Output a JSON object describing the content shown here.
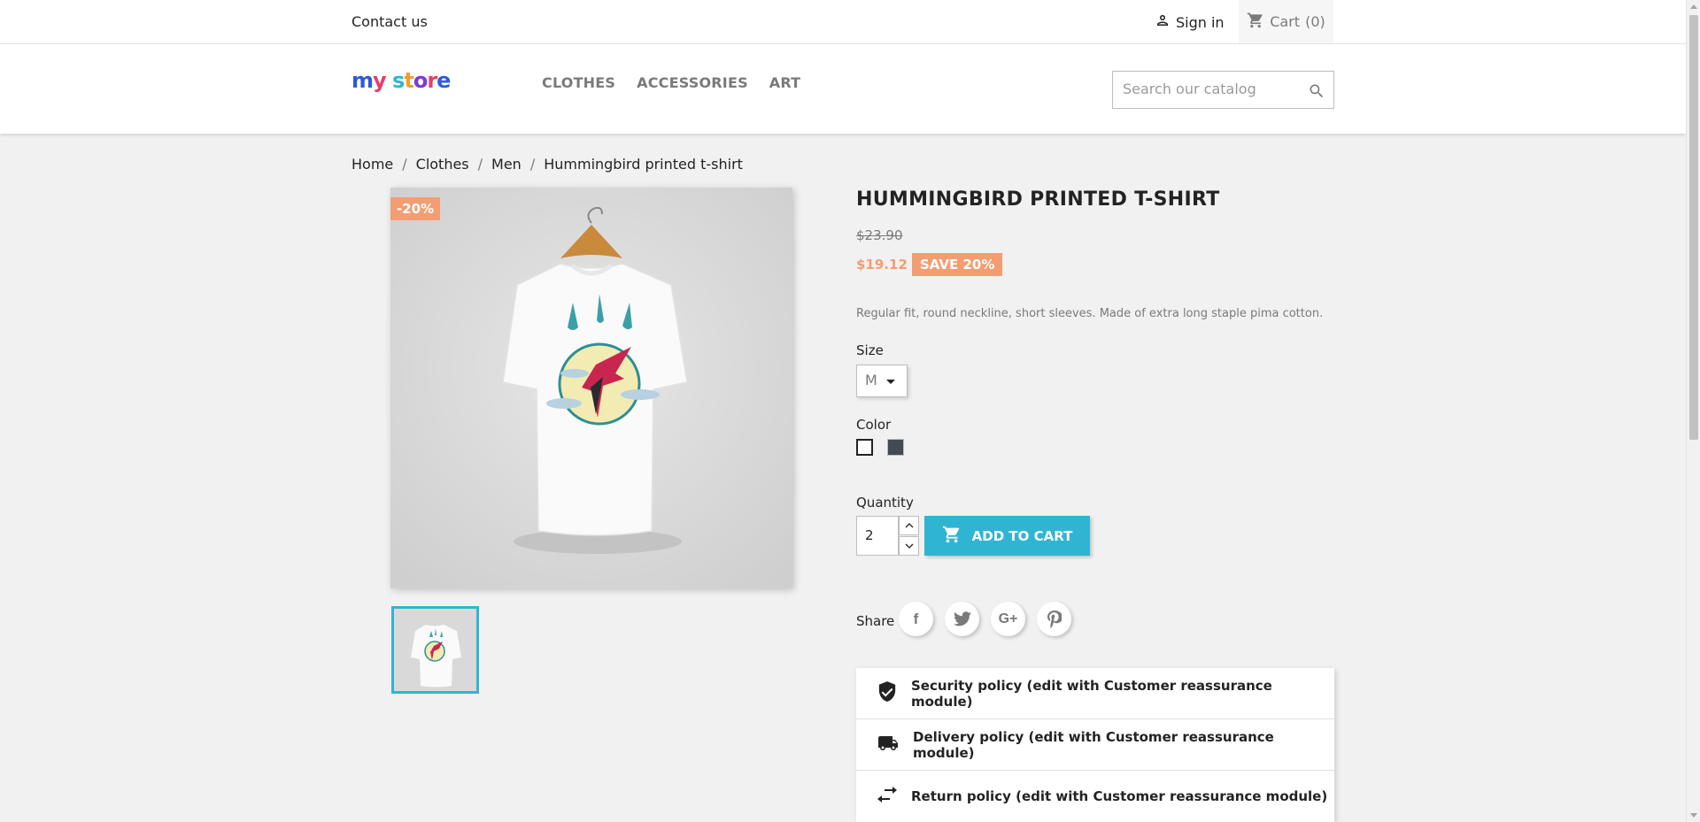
{
  "topbar": {
    "contact_label": "Contact us",
    "signin_label": "Sign in",
    "cart_label": "Cart",
    "cart_count": "(0)"
  },
  "header": {
    "logo_text": "my store",
    "nav": [
      "CLOTHES",
      "ACCESSORIES",
      "ART"
    ],
    "search_placeholder": "Search our catalog"
  },
  "breadcrumb": {
    "items": [
      "Home",
      "Clothes",
      "Men",
      "Hummingbird printed t-shirt"
    ],
    "separator": "/"
  },
  "product": {
    "discount_flag": "-20%",
    "title": "HUMMINGBIRD PRINTED T-SHIRT",
    "old_price": "$23.90",
    "new_price": "$19.12",
    "save_badge": "SAVE 20%",
    "description": "Regular fit, round neckline, short sleeves. Made of extra long staple pima cotton.",
    "size_label": "Size",
    "size_value": "M",
    "color_label": "Color",
    "colors": [
      {
        "name": "White",
        "hex": "#ffffff",
        "selected": true
      },
      {
        "name": "Black",
        "hex": "#434a54",
        "selected": false
      }
    ],
    "quantity_label": "Quantity",
    "quantity_value": "2",
    "add_to_cart_label": "ADD TO CART",
    "share_label": "Share",
    "share_buttons": [
      "facebook-icon",
      "twitter-icon",
      "googleplus-icon",
      "pinterest-icon"
    ]
  },
  "reassurance": [
    {
      "icon": "shield-check-icon",
      "label": "Security policy (edit with Customer reassurance module)"
    },
    {
      "icon": "truck-icon",
      "label": "Delivery policy (edit with Customer reassurance module)"
    },
    {
      "icon": "swap-arrows-icon",
      "label": "Return policy (edit with Customer reassurance module)"
    }
  ],
  "colors": {
    "accent": "#2fb5d2",
    "discount": "#f39d72",
    "text": "#232323",
    "muted": "#7a7a7a"
  }
}
